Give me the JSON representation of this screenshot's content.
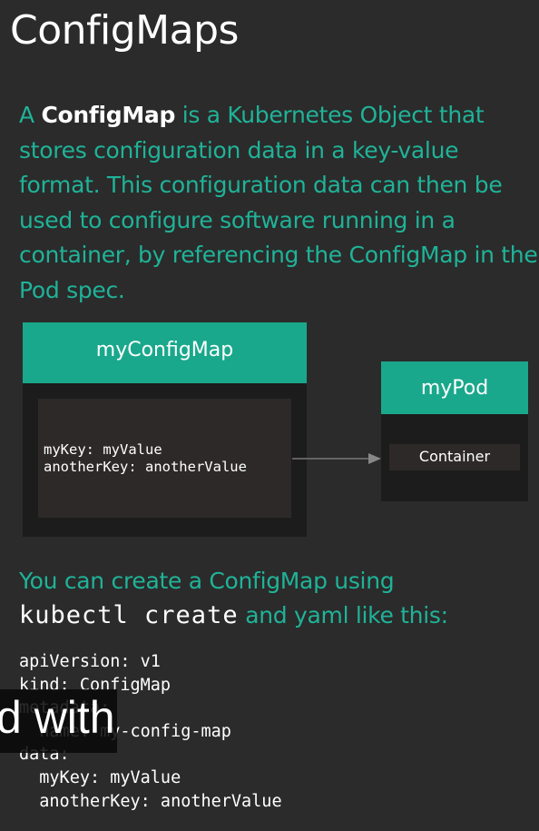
{
  "title": "ConfigMaps",
  "intro": {
    "prefix": "A ",
    "term": "ConfigMap",
    "rest": " is a Kubernetes Object that stores configuration data in a key-value format. This configuration data can then be used to configure software running in a container, by referencing the ConfigMap in the Pod spec."
  },
  "diagram": {
    "configmap_name": "myConfigMap",
    "entries": [
      "myKey: myValue",
      "anotherKey: anotherValue"
    ],
    "pod_name": "myPod",
    "container_label": "Container"
  },
  "create": {
    "line1": "You can create a ConfigMap using",
    "command": "kubectl create",
    "line2_tail": " and yaml like this:"
  },
  "yaml_lines": [
    "apiVersion: v1",
    "kind: ConfigMap",
    "metadata:",
    "  name: my-config-map",
    "data:",
    "  myKey: myValue",
    "  anotherKey: anotherValue"
  ],
  "caption": "d with",
  "colors": {
    "background": "#2b2b2b",
    "accent_text": "#1fb398",
    "header_fill": "#1aa88c",
    "box_fill": "#1c1c1c",
    "inner_fill": "#2e2929"
  }
}
